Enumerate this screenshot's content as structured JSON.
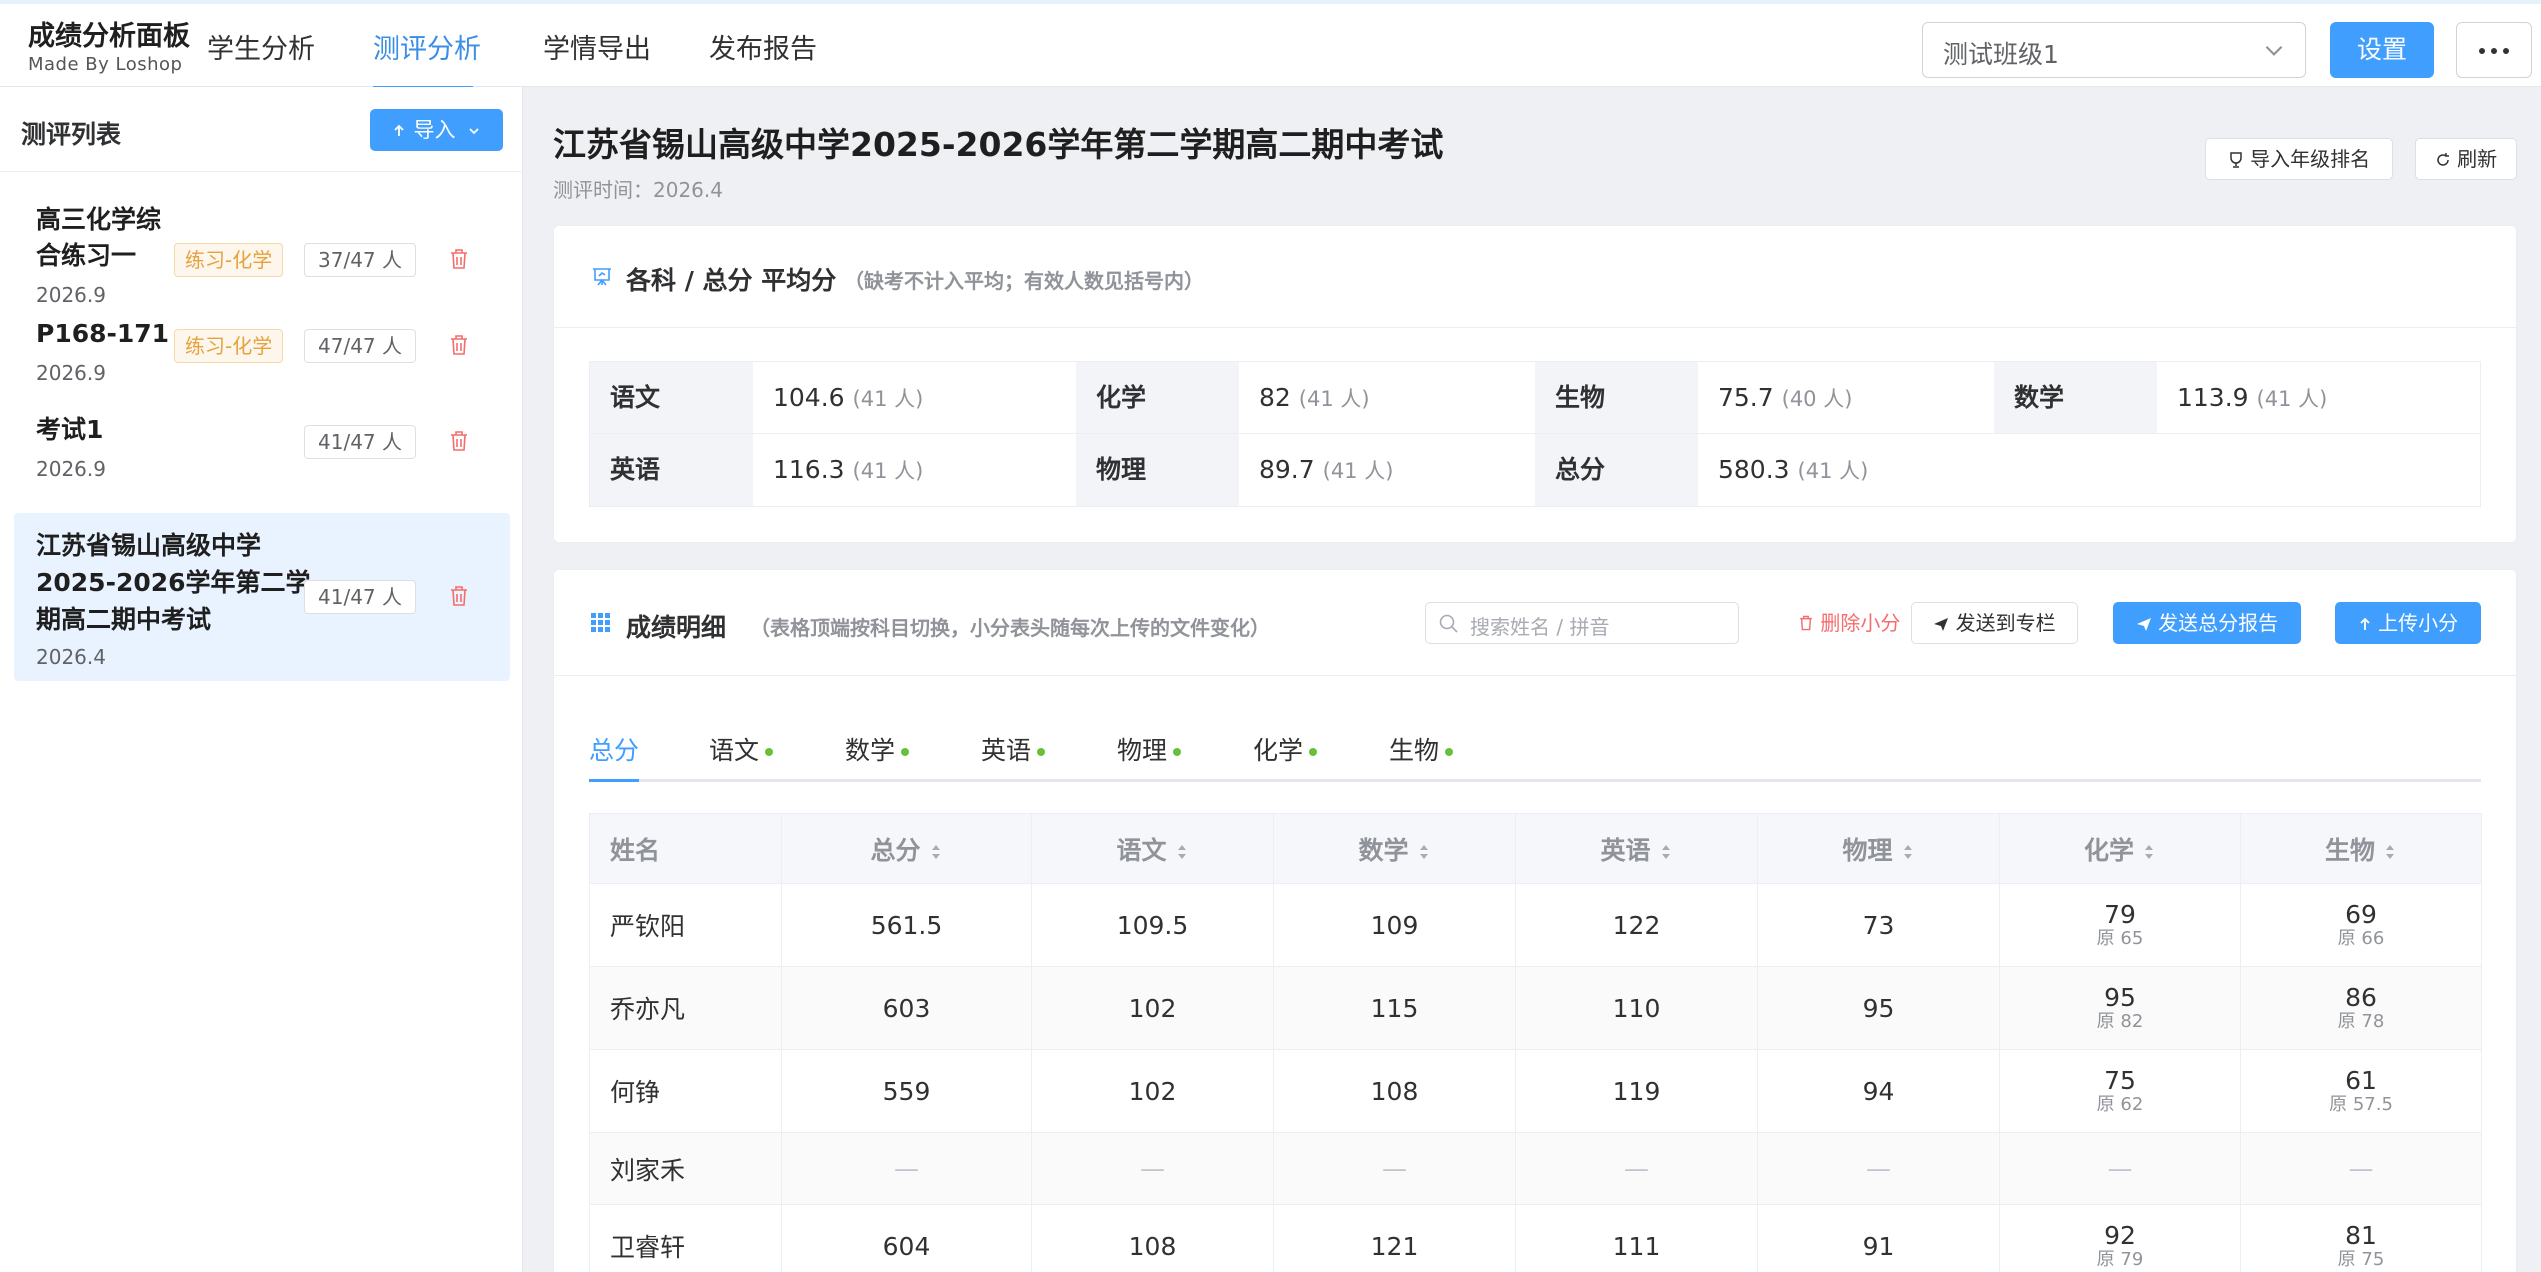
{
  "brand": {
    "title": "成绩分析面板",
    "subtitle": "Made By Loshop"
  },
  "nav": [
    "学生分析",
    "测评分析",
    "学情导出",
    "发布报告"
  ],
  "class_select": {
    "value": "测试班级1"
  },
  "settings_label": "设置",
  "sidebar": {
    "title": "测评列表",
    "import_label": "导入",
    "exams": [
      {
        "name_line1": "高三化学综",
        "name_line2": "合练习一",
        "date": "2026.9",
        "tag": "练习-化学",
        "count": "37/47 人"
      },
      {
        "name_line1": "P168-171",
        "date": "2026.9",
        "tag": "练习-化学",
        "count": "47/47 人"
      },
      {
        "name_line1": "考试1",
        "date": "2026.9",
        "count": "41/47 人"
      },
      {
        "name_line1": "江苏省锡山高级中学",
        "name_line2": "2025-2026学年第二学",
        "name_line3": "期高二期中考试",
        "date": "2026.4",
        "count": "41/47 人"
      }
    ]
  },
  "exam": {
    "title": "江苏省锡山高级中学2025-2026学年第二学期高二期中考试",
    "time": "测评时间：2026.4",
    "import_rank_label": "导入年级排名",
    "refresh_label": "刷新"
  },
  "averages": {
    "title": "各科 / 总分 平均分",
    "note": "（缺考不计入平均；有效人数见括号内）",
    "items": [
      {
        "subject": "语文",
        "value": "104.6",
        "count": "(41 人)"
      },
      {
        "subject": "化学",
        "value": "82",
        "count": "(41 人)"
      },
      {
        "subject": "生物",
        "value": "75.7",
        "count": "(40 人)"
      },
      {
        "subject": "数学",
        "value": "113.9",
        "count": "(41 人)"
      },
      {
        "subject": "英语",
        "value": "116.3",
        "count": "(41 人)"
      },
      {
        "subject": "物理",
        "value": "89.7",
        "count": "(41 人)"
      },
      {
        "subject": "总分",
        "value": "580.3",
        "count": "(41 人)"
      }
    ]
  },
  "details": {
    "title": "成绩明细",
    "note": "（表格顶端按科目切换，小分表头随每次上传的文件变化）",
    "search_placeholder": "搜索姓名 / 拼音",
    "delete_label": "删除小分",
    "send_column_label": "发送到专栏",
    "send_report_label": "发送总分报告",
    "upload_label": "上传小分",
    "tabs": [
      "总分",
      "语文",
      "数学",
      "英语",
      "物理",
      "化学",
      "生物"
    ],
    "columns": [
      "姓名",
      "总分",
      "语文",
      "数学",
      "英语",
      "物理",
      "化学",
      "生物"
    ],
    "rows": [
      {
        "name": "严钦阳",
        "total": "561.5",
        "chinese": "109.5",
        "math": "109",
        "english": "122",
        "physics": "73",
        "chem": "79",
        "chem_orig": "原 65",
        "bio": "69",
        "bio_orig": "原 66"
      },
      {
        "name": "乔亦凡",
        "total": "603",
        "chinese": "102",
        "math": "115",
        "english": "110",
        "physics": "95",
        "chem": "95",
        "chem_orig": "原 82",
        "bio": "86",
        "bio_orig": "原 78"
      },
      {
        "name": "何铮",
        "total": "559",
        "chinese": "102",
        "math": "108",
        "english": "119",
        "physics": "94",
        "chem": "75",
        "chem_orig": "原 62",
        "bio": "61",
        "bio_orig": "原 57.5"
      },
      {
        "name": "刘家禾",
        "total": "—",
        "chinese": "—",
        "math": "—",
        "english": "—",
        "physics": "—",
        "chem": "—",
        "bio": "—"
      },
      {
        "name": "卫睿轩",
        "total": "604",
        "chinese": "108",
        "math": "121",
        "english": "111",
        "physics": "91",
        "chem": "92",
        "chem_orig": "原 79",
        "bio": "81",
        "bio_orig": "原 75"
      }
    ]
  }
}
